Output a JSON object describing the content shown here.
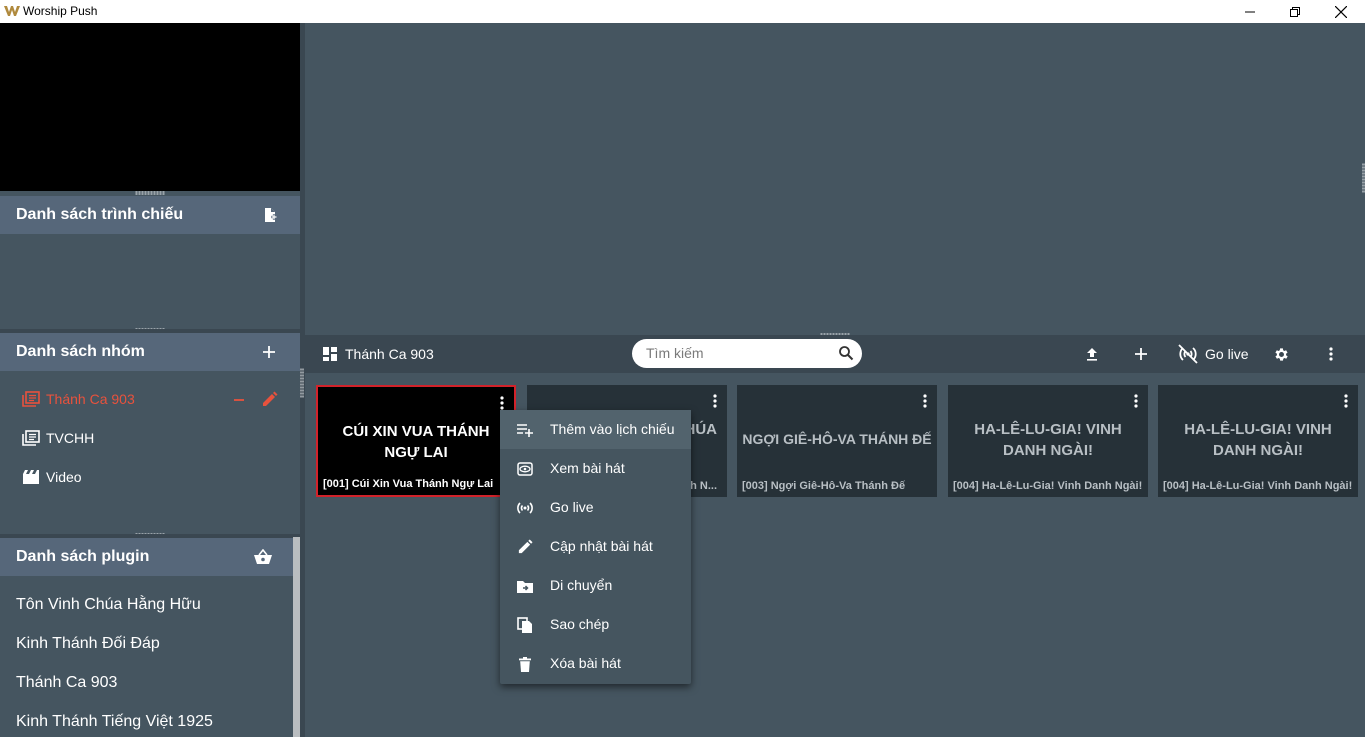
{
  "window": {
    "title": "Worship Push"
  },
  "panels": {
    "presentation": {
      "title": "Danh sách trình chiếu"
    },
    "groups": {
      "title": "Danh sách nhóm",
      "items": [
        {
          "label": "Thánh Ca 903",
          "active": true
        },
        {
          "label": "TVCHH",
          "active": false
        },
        {
          "label": "Video",
          "active": false
        }
      ]
    },
    "plugins": {
      "title": "Danh sách plugin",
      "items": [
        "Tôn Vinh Chúa Hằng Hữu",
        "Kinh Thánh Đối Đáp",
        "Thánh Ca 903",
        "Kinh Thánh Tiếng Việt 1925"
      ]
    }
  },
  "toolbar": {
    "title": "Thánh Ca 903",
    "search_placeholder": "Tìm kiếm",
    "golive_label": "Go live"
  },
  "cards": [
    {
      "title": "CÚI XIN VUA THÁNH NGỰ LAI",
      "caption": "[001] Cúi Xin Vua Thánh Ngự Lai",
      "active": true
    },
    {
      "title": "CHÚA",
      "caption": "h N...",
      "active": false
    },
    {
      "title": "NGỢI GIÊ-HÔ-VA THÁNH ĐẾ",
      "caption": "[003] Ngợi Giê-Hô-Va Thánh Đế",
      "active": false
    },
    {
      "title": "HA-LÊ-LU-GIA! VINH DANH NGÀI!",
      "caption": "[004] Ha-Lê-Lu-Gia! Vinh Danh Ngài!",
      "active": false
    },
    {
      "title": "HA-LÊ-LU-GIA! VINH DANH NGÀI!",
      "caption": "[004] Ha-Lê-Lu-Gia! Vinh Danh Ngài!",
      "active": false
    }
  ],
  "context_menu": [
    {
      "label": "Thêm vào lịch chiếu",
      "icon": "playlist-add-icon"
    },
    {
      "label": "Xem bài hát",
      "icon": "eye-icon"
    },
    {
      "label": "Go live",
      "icon": "broadcast-icon"
    },
    {
      "label": "Cập nhật bài hát",
      "icon": "pencil-icon"
    },
    {
      "label": "Di chuyển",
      "icon": "folder-move-icon"
    },
    {
      "label": "Sao chép",
      "icon": "copy-icon"
    },
    {
      "label": "Xóa bài hát",
      "icon": "trash-icon"
    }
  ],
  "colors": {
    "background": "#455560",
    "panel_header": "#56677a",
    "accent_active": "#e8523d",
    "card_border_active": "#d2222a"
  }
}
